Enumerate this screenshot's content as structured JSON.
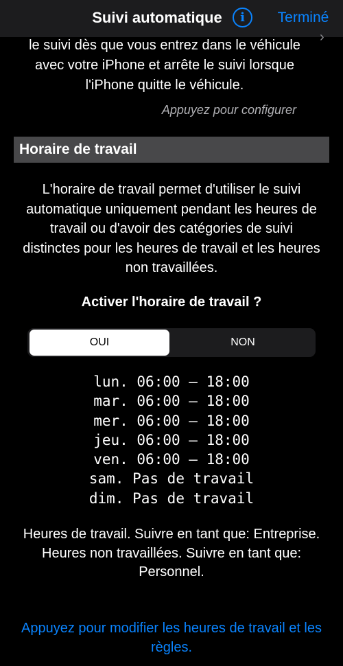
{
  "nav": {
    "title": "Suivi automatique",
    "info_glyph": "i",
    "done_label": "Terminé",
    "chevron": "›"
  },
  "auto_tracking": {
    "text": "le suivi dès que vous entrez dans le véhicule avec votre iPhone et arrête le suivi lorsque l'iPhone quitte le véhicule.",
    "tap_to_configure": "Appuyez pour configurer"
  },
  "work_schedule": {
    "header": "Horaire de travail",
    "description": "L'horaire de travail permet d'utiliser le suivi automatique uniquement pendant les heures de travail ou d'avoir des catégories de suivi distinctes pour les heures de travail et les heures non travaillées.",
    "question": "Activer l'horaire de travail ?",
    "toggle": {
      "options": [
        "OUI",
        "NON"
      ],
      "selected": "OUI"
    },
    "days": [
      "lun. 06:00 – 18:00",
      "mar. 06:00 – 18:00",
      "mer. 06:00 – 18:00",
      "jeu. 06:00 – 18:00",
      "ven. 06:00 – 18:00",
      "sam. Pas de travail",
      "dim. Pas de travail"
    ],
    "summary_work": "Heures de travail. Suivre en tant que: Entreprise.",
    "summary_off": "Heures non travaillées. Suivre en tant que: Personnel.",
    "edit_link": "Appuyez pour modifier les heures de travail et les règles."
  },
  "colors": {
    "background": "#000000",
    "nav_background": "#1c1c1e",
    "section_header": "#48484a",
    "accent_blue": "#0a84ff",
    "secondary_text": "#b0b0b4"
  },
  "icons": {
    "info": "info-circle-icon",
    "disclosure": "chevron-right-icon"
  }
}
